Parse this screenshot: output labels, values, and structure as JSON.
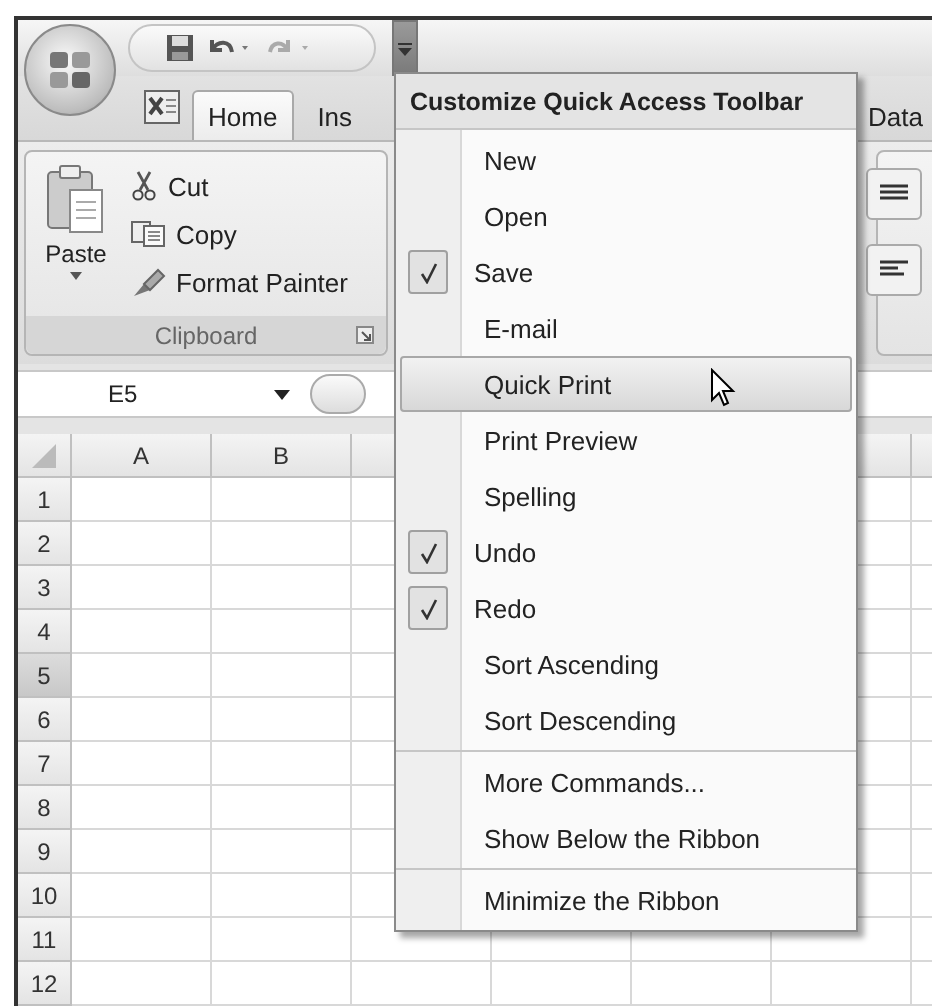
{
  "quick_access_toolbar": {
    "customize_expanded": true
  },
  "tabs": [
    {
      "label": "Home",
      "selected": true
    },
    {
      "label": "Ins",
      "selected": false
    },
    {
      "label": "Data",
      "selected": false
    }
  ],
  "clipboard_group": {
    "title": "Clipboard",
    "paste": "Paste",
    "commands": [
      {
        "kind": "cut",
        "label": "Cut"
      },
      {
        "kind": "copy",
        "label": "Copy"
      },
      {
        "kind": "painter",
        "label": "Format Painter"
      }
    ]
  },
  "name_box": "E5",
  "sheet": {
    "columns": [
      "A",
      "B"
    ],
    "rows": [
      {
        "label": "1",
        "selected": false
      },
      {
        "label": "2",
        "selected": false
      },
      {
        "label": "3",
        "selected": false
      },
      {
        "label": "4",
        "selected": false
      },
      {
        "label": "5",
        "selected": true
      },
      {
        "label": "6",
        "selected": false
      },
      {
        "label": "7",
        "selected": false
      },
      {
        "label": "8",
        "selected": false
      },
      {
        "label": "9",
        "selected": false
      },
      {
        "label": "10",
        "selected": false
      },
      {
        "label": "11",
        "selected": false
      },
      {
        "label": "12",
        "selected": false
      }
    ]
  },
  "menu": {
    "title": "Customize Quick Access Toolbar",
    "sections": [
      {
        "items": [
          {
            "label": "New",
            "checked": false,
            "selected": false
          },
          {
            "label": "Open",
            "checked": false,
            "selected": false
          },
          {
            "label": "Save",
            "checked": true,
            "selected": false
          },
          {
            "label": "E-mail",
            "checked": false,
            "selected": false
          },
          {
            "label": "Quick Print",
            "checked": false,
            "selected": true
          },
          {
            "label": "Print Preview",
            "checked": false,
            "selected": false
          },
          {
            "label": "Spelling",
            "checked": false,
            "selected": false
          },
          {
            "label": "Undo",
            "checked": true,
            "selected": false
          },
          {
            "label": "Redo",
            "checked": true,
            "selected": false
          },
          {
            "label": "Sort Ascending",
            "checked": false,
            "selected": false
          },
          {
            "label": "Sort Descending",
            "checked": false,
            "selected": false
          }
        ]
      },
      {
        "items": [
          {
            "label": "More Commands...",
            "selected": false
          },
          {
            "label": "Show Below the Ribbon",
            "selected": false
          }
        ]
      },
      {
        "items": [
          {
            "label": "Minimize the Ribbon",
            "selected": false
          }
        ]
      }
    ]
  }
}
